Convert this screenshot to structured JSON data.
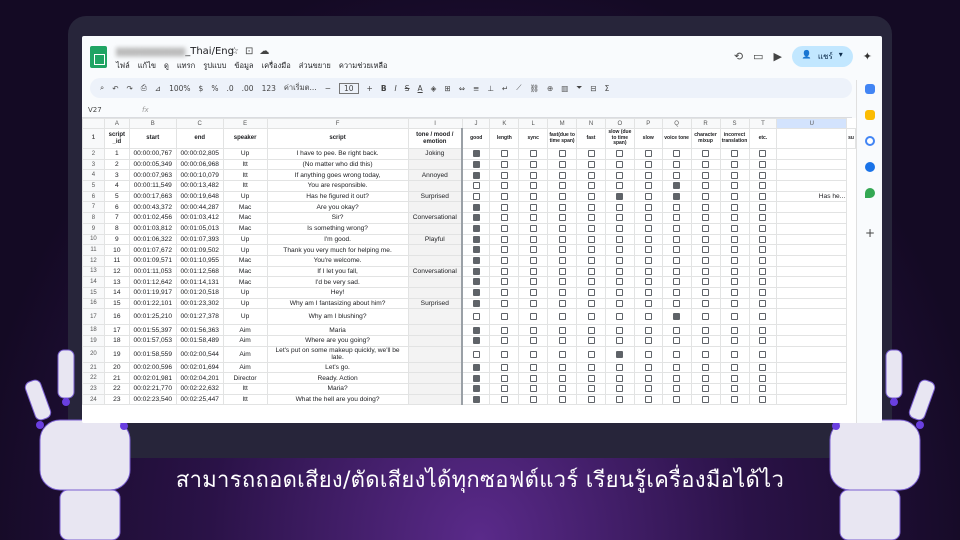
{
  "doc": {
    "title": "_Thai/Eng",
    "title_prefix_blurred": "▆▆▆▆▆▆▆▆▆"
  },
  "menus": [
    "ไฟล์",
    "แก้ไข",
    "ดู",
    "แทรก",
    "รูปแบบ",
    "ข้อมูล",
    "เครื่องมือ",
    "ส่วนขยาย",
    "ความช่วยเหลือ"
  ],
  "toolbar": {
    "zoom": "100%",
    "currency": "$",
    "percent": "%",
    "dec_less": ".0",
    "dec_more": ".00",
    "num": "123",
    "font": "ค่าเริ่มต...",
    "size": "10",
    "bold": "B",
    "italic": "I",
    "strike": "S",
    "color": "A"
  },
  "share_label": "แชร์",
  "cell_ref": "V27",
  "fx": "fx",
  "columns": [
    "A",
    "B",
    "C",
    "E",
    "F",
    "I",
    "J",
    "K",
    "L",
    "M",
    "N",
    "O",
    "P",
    "Q",
    "R",
    "S",
    "T",
    "U",
    "V"
  ],
  "headers": [
    "script _id",
    "start",
    "end",
    "speaker",
    "script",
    "tone / mood / emotion",
    "good",
    "length",
    "sync",
    "fast(due to time span)",
    "fast",
    "slow (due to time span)",
    "slow",
    "voice tone",
    "character mixup",
    "incorrect translation",
    "etc.",
    "su"
  ],
  "rows": [
    {
      "n": "2",
      "id": "1",
      "start": "00:00:00,767",
      "end": "00:00:02,805",
      "spk": "Up",
      "script": "I have to pee. Be right back.",
      "tone": "Joking",
      "checks": [
        1,
        0,
        0,
        0,
        0,
        0,
        0,
        0,
        0,
        0,
        0
      ],
      "extra": ""
    },
    {
      "n": "3",
      "id": "2",
      "start": "00:00:05,349",
      "end": "00:00:06,968",
      "spk": "Itt",
      "script": "(No matter who did this)",
      "tone": "",
      "checks": [
        1,
        0,
        0,
        0,
        0,
        0,
        0,
        0,
        0,
        0,
        0
      ],
      "extra": ""
    },
    {
      "n": "4",
      "id": "3",
      "start": "00:00:07,963",
      "end": "00:00:10,079",
      "spk": "Itt",
      "script": "If anything goes wrong today,",
      "tone": "Annoyed",
      "checks": [
        1,
        0,
        0,
        0,
        0,
        0,
        0,
        0,
        0,
        0,
        0
      ],
      "extra": ""
    },
    {
      "n": "5",
      "id": "4",
      "start": "00:00:11,549",
      "end": "00:00:13,482",
      "spk": "Itt",
      "script": "You are responsible.",
      "tone": "",
      "checks": [
        0,
        0,
        0,
        0,
        0,
        0,
        0,
        1,
        0,
        0,
        0
      ],
      "extra": ""
    },
    {
      "n": "6",
      "id": "5",
      "start": "00:00:17,663",
      "end": "00:00:19,648",
      "spk": "Up",
      "script": "Has he figured it out?",
      "tone": "Surprised",
      "checks": [
        0,
        0,
        0,
        0,
        0,
        1,
        0,
        1,
        0,
        0,
        0
      ],
      "extra": "Has he..."
    },
    {
      "n": "7",
      "id": "6",
      "start": "00:00:43,372",
      "end": "00:00:44,287",
      "spk": "Mac",
      "script": "Are you okay?",
      "tone": "",
      "checks": [
        1,
        0,
        0,
        0,
        0,
        0,
        0,
        0,
        0,
        0,
        0
      ],
      "extra": ""
    },
    {
      "n": "8",
      "id": "7",
      "start": "00:01:02,456",
      "end": "00:01:03,412",
      "spk": "Mac",
      "script": "Sir?",
      "tone": "Conversational",
      "checks": [
        1,
        0,
        0,
        0,
        0,
        0,
        0,
        0,
        0,
        0,
        0
      ],
      "extra": ""
    },
    {
      "n": "9",
      "id": "8",
      "start": "00:01:03,812",
      "end": "00:01:05,013",
      "spk": "Mac",
      "script": "Is something wrong?",
      "tone": "",
      "checks": [
        1,
        0,
        0,
        0,
        0,
        0,
        0,
        0,
        0,
        0,
        0
      ],
      "extra": ""
    },
    {
      "n": "10",
      "id": "9",
      "start": "00:01:06,322",
      "end": "00:01:07,393",
      "spk": "Up",
      "script": "I'm good.",
      "tone": "Playful",
      "checks": [
        1,
        0,
        0,
        0,
        0,
        0,
        0,
        0,
        0,
        0,
        0
      ],
      "extra": ""
    },
    {
      "n": "11",
      "id": "10",
      "start": "00:01:07,672",
      "end": "00:01:09,502",
      "spk": "Up",
      "script": "Thank you very much for helping me.",
      "tone": "",
      "checks": [
        1,
        0,
        0,
        0,
        0,
        0,
        0,
        0,
        0,
        0,
        0
      ],
      "extra": ""
    },
    {
      "n": "12",
      "id": "11",
      "start": "00:01:09,571",
      "end": "00:01:10,955",
      "spk": "Mac",
      "script": "You're welcome.",
      "tone": "",
      "checks": [
        1,
        0,
        0,
        0,
        0,
        0,
        0,
        0,
        0,
        0,
        0
      ],
      "extra": ""
    },
    {
      "n": "13",
      "id": "12",
      "start": "00:01:11,053",
      "end": "00:01:12,568",
      "spk": "Mac",
      "script": "If I let you fall,",
      "tone": "Conversational",
      "checks": [
        1,
        0,
        0,
        0,
        0,
        0,
        0,
        0,
        0,
        0,
        0
      ],
      "extra": ""
    },
    {
      "n": "14",
      "id": "13",
      "start": "00:01:12,642",
      "end": "00:01:14,131",
      "spk": "Mac",
      "script": "I'd be very sad.",
      "tone": "",
      "checks": [
        1,
        0,
        0,
        0,
        0,
        0,
        0,
        0,
        0,
        0,
        0
      ],
      "extra": ""
    },
    {
      "n": "15",
      "id": "14",
      "start": "00:01:19,917",
      "end": "00:01:20,518",
      "spk": "Up",
      "script": "Hey!",
      "tone": "",
      "checks": [
        1,
        0,
        0,
        0,
        0,
        0,
        0,
        0,
        0,
        0,
        0
      ],
      "extra": ""
    },
    {
      "n": "16",
      "id": "15",
      "start": "00:01:22,101",
      "end": "00:01:23,302",
      "spk": "Up",
      "script": "Why am I fantasizing about him?",
      "tone": "Surprised",
      "checks": [
        1,
        0,
        0,
        0,
        0,
        0,
        0,
        0,
        0,
        0,
        0
      ],
      "extra": ""
    },
    {
      "n": "17",
      "id": "16",
      "start": "00:01:25,210",
      "end": "00:01:27,378",
      "spk": "Up",
      "script": "Why am I blushing?",
      "tone": "",
      "checks": [
        0,
        0,
        0,
        0,
        0,
        0,
        0,
        1,
        0,
        0,
        0
      ],
      "extra": "",
      "tall": true
    },
    {
      "n": "18",
      "id": "17",
      "start": "00:01:55,397",
      "end": "00:01:56,363",
      "spk": "Aim",
      "script": "Maria",
      "tone": "",
      "checks": [
        1,
        0,
        0,
        0,
        0,
        0,
        0,
        0,
        0,
        0,
        0
      ],
      "extra": ""
    },
    {
      "n": "19",
      "id": "18",
      "start": "00:01:57,053",
      "end": "00:01:58,489",
      "spk": "Aim",
      "script": "Where are you going?",
      "tone": "",
      "checks": [
        1,
        0,
        0,
        0,
        0,
        0,
        0,
        0,
        0,
        0,
        0
      ],
      "extra": ""
    },
    {
      "n": "20",
      "id": "19",
      "start": "00:01:58,559",
      "end": "00:02:00,544",
      "spk": "Aim",
      "script": "Let's put on some makeup quickly, we'll be late.",
      "tone": "",
      "checks": [
        0,
        0,
        0,
        0,
        0,
        1,
        0,
        0,
        0,
        0,
        0
      ],
      "extra": "",
      "tall": true
    },
    {
      "n": "21",
      "id": "20",
      "start": "00:02:00,596",
      "end": "00:02:01,694",
      "spk": "Aim",
      "script": "Let's go.",
      "tone": "",
      "checks": [
        1,
        0,
        0,
        0,
        0,
        0,
        0,
        0,
        0,
        0,
        0
      ],
      "extra": ""
    },
    {
      "n": "22",
      "id": "21",
      "start": "00:02:01,981",
      "end": "00:02:04,201",
      "spk": "Director",
      "script": "Ready. Action",
      "tone": "",
      "checks": [
        1,
        0,
        0,
        0,
        0,
        0,
        0,
        0,
        0,
        0,
        0
      ],
      "extra": ""
    },
    {
      "n": "23",
      "id": "22",
      "start": "00:02:21,770",
      "end": "00:02:22,632",
      "spk": "Itt",
      "script": "Maria?",
      "tone": "",
      "checks": [
        1,
        0,
        0,
        0,
        0,
        0,
        0,
        0,
        0,
        0,
        0
      ],
      "extra": ""
    },
    {
      "n": "24",
      "id": "23",
      "start": "00:02:23,540",
      "end": "00:02:25,447",
      "spk": "Itt",
      "script": "What the hell are you doing?",
      "tone": "",
      "checks": [
        1,
        0,
        0,
        0,
        0,
        0,
        0,
        0,
        0,
        0,
        0
      ],
      "extra": ""
    }
  ],
  "caption": "สามารถถอดเสียง/ตัดเสียงได้ทุกซอฟต์แวร์ เรียนรู้เครื่องมือได้ไว"
}
